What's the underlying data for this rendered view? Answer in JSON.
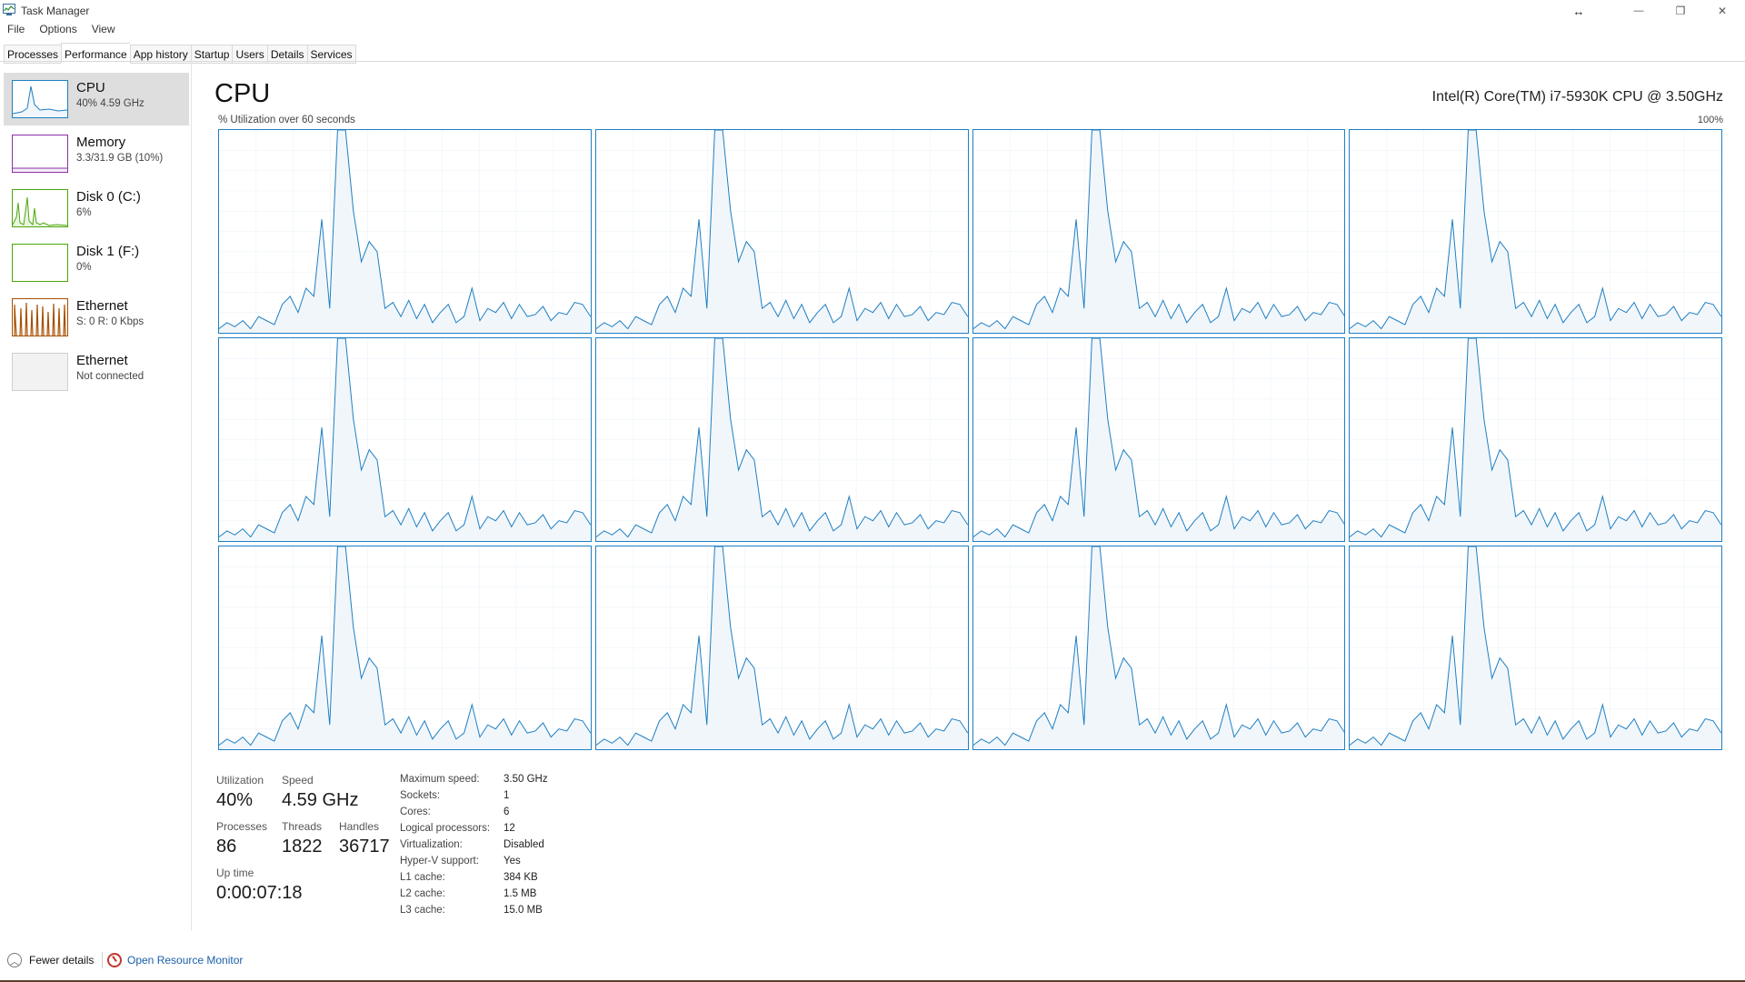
{
  "window": {
    "title": "Task Manager",
    "icon": "task-manager-icon",
    "resize_glyph": "↔",
    "minimize_glyph": "—",
    "restore_glyph": "❐",
    "close_glyph": "✕"
  },
  "menu": [
    {
      "label": "File"
    },
    {
      "label": "Options"
    },
    {
      "label": "View"
    }
  ],
  "tabs": [
    {
      "label": "Processes",
      "active": false
    },
    {
      "label": "Performance",
      "active": true
    },
    {
      "label": "App history",
      "active": false
    },
    {
      "label": "Startup",
      "active": false
    },
    {
      "label": "Users",
      "active": false
    },
    {
      "label": "Details",
      "active": false
    },
    {
      "label": "Services",
      "active": false
    }
  ],
  "sidebar": {
    "items": [
      {
        "title": "CPU",
        "subtitle": "40% 4.59 GHz",
        "color": "#1f7fc2",
        "active": true
      },
      {
        "title": "Memory",
        "subtitle": "3.3/31.9 GB (10%)",
        "color": "#8b2fa8",
        "active": false
      },
      {
        "title": "Disk 0 (C:)",
        "subtitle": "6%",
        "color": "#4da60c",
        "active": false
      },
      {
        "title": "Disk 1 (F:)",
        "subtitle": "0%",
        "color": "#4da60c",
        "active": false
      },
      {
        "title": "Ethernet",
        "subtitle": "S: 0 R: 0 Kbps",
        "color": "#a74f01",
        "active": false
      },
      {
        "title": "Ethernet",
        "subtitle": "Not connected",
        "color": "#aaaaaa",
        "active": false
      }
    ]
  },
  "main": {
    "title": "CPU",
    "cpu_model": "Intel(R) Core(TM) i7-5930K CPU @ 3.50GHz",
    "util_label": "% Utilization over 60 seconds",
    "max_label": "100%",
    "accent": "#1f7fc2",
    "fill": "#f1f6fb",
    "grid": "#d9e8f5"
  },
  "cores": [
    [
      2,
      5,
      3,
      6,
      2,
      8,
      6,
      4,
      14,
      18,
      10,
      22,
      18,
      56,
      12,
      100,
      100,
      60,
      35,
      45,
      40,
      12,
      15,
      8,
      16,
      7,
      14,
      5,
      10,
      14,
      5,
      8,
      22,
      6,
      12,
      10,
      15,
      7,
      14,
      8,
      9,
      13,
      6,
      10,
      9,
      15,
      14,
      8
    ]
  ],
  "stats": {
    "utilization_label": "Utilization",
    "utilization": "40%",
    "speed_label": "Speed",
    "speed": "4.59 GHz",
    "processes_label": "Processes",
    "processes": "86",
    "threads_label": "Threads",
    "threads": "1822",
    "handles_label": "Handles",
    "handles": "36717",
    "uptime_label": "Up time",
    "uptime": "0:00:07:18"
  },
  "info": [
    {
      "label": "Maximum speed:",
      "value": "3.50 GHz"
    },
    {
      "label": "Sockets:",
      "value": "1"
    },
    {
      "label": "Cores:",
      "value": "6"
    },
    {
      "label": "Logical processors:",
      "value": "12"
    },
    {
      "label": "Virtualization:",
      "value": "Disabled"
    },
    {
      "label": "Hyper-V support:",
      "value": "Yes"
    },
    {
      "label": "L1 cache:",
      "value": "384 KB"
    },
    {
      "label": "L2 cache:",
      "value": "1.5 MB"
    },
    {
      "label": "L3 cache:",
      "value": "15.0 MB"
    }
  ],
  "footer": {
    "fewer_details": "Fewer details",
    "fewer_icon_glyph": "︿",
    "resource_monitor": "Open Resource Monitor"
  }
}
